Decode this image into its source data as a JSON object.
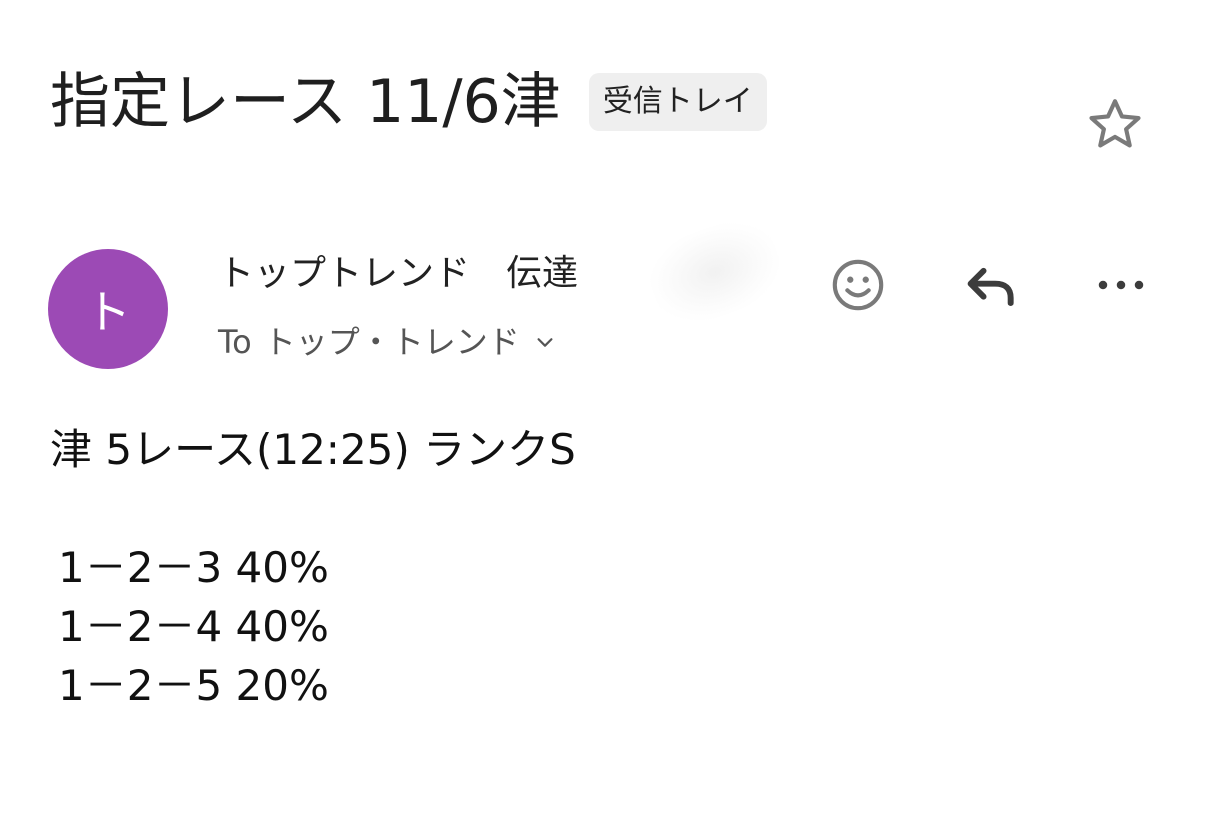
{
  "email": {
    "subject": "指定レース 11/6津",
    "label": "受信トレイ",
    "sender": {
      "avatar_initial": "ト",
      "avatar_color": "#9c4ab5",
      "name": "トップトレンド　伝達",
      "recipient_prefix": "To",
      "recipient": "トップ・トレンド"
    },
    "body": {
      "race_line": "津 5レース(12:25) ランクS",
      "picks": [
        "1－2－3  40%",
        "1－2－4  40%",
        "1－2－5  20%"
      ]
    }
  },
  "icons": {
    "star": "star-outline-icon",
    "emoji": "smiley-face-icon",
    "reply": "reply-arrow-icon",
    "more": "more-horizontal-icon",
    "recipient_details": "chevron-down-icon"
  },
  "colors": {
    "icon_gray": "#7a7a7a",
    "icon_dark": "#3c3c3c",
    "label_chip_bg": "#efefef"
  }
}
